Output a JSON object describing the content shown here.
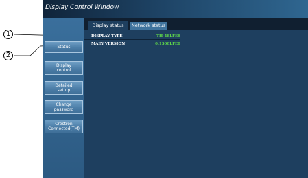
{
  "window": {
    "title": "Display Control Window"
  },
  "tabs": [
    {
      "label": "Display status",
      "active": true
    },
    {
      "label": "Network status",
      "active": false
    }
  ],
  "sidebar": {
    "items": [
      {
        "label": "Status"
      },
      {
        "label": "Display\ncontrol"
      },
      {
        "label": "Detailed\nset up"
      },
      {
        "label": "Change\npassword"
      },
      {
        "label": "Crestron\nConnected(TM)"
      }
    ]
  },
  "display_status": {
    "rows": [
      {
        "label": "DISPLAY TYPE",
        "value": "TH-48LFE8"
      },
      {
        "label": "MAIN VERSION",
        "value": "0.1300LFE8"
      }
    ]
  },
  "callouts": [
    {
      "label": "1"
    },
    {
      "label": "2"
    }
  ],
  "colors": {
    "window_bg": "#1e3f5f",
    "value_green": "#5ed44a",
    "tab_active": "#1e3f5f",
    "tab_inactive": "#40749e"
  }
}
